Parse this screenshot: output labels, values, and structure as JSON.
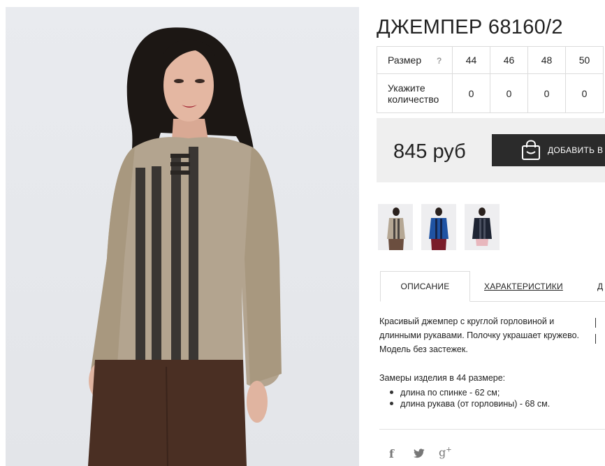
{
  "product": {
    "title": "ДЖЕМПЕР 68160/2"
  },
  "sizes": {
    "size_label": "Размер",
    "help": "?",
    "quantity_label_line1": "Укажите",
    "quantity_label_line2": "количество",
    "columns": [
      {
        "size": "44",
        "qty": "0"
      },
      {
        "size": "46",
        "qty": "0"
      },
      {
        "size": "48",
        "qty": "0"
      },
      {
        "size": "50",
        "qty": "0"
      }
    ]
  },
  "price": {
    "value": "845 руб",
    "add_to_cart": "ДОБАВИТЬ В"
  },
  "thumbnails": [
    "beige-jumper",
    "blue-jumper",
    "navy-jumper"
  ],
  "tabs": {
    "description": "ОПИСАНИЕ",
    "characteristics": "ХАРАКТЕРИСТИКИ",
    "third": "Д"
  },
  "description": {
    "text": "Красивый джемпер с круглой горловиной и длинными рукавами. Полочку украшает кружево. Модель без застежек.",
    "measures_title": "Замеры изделия в 44 размере:",
    "measures": [
      "длина по спинке - 62 см;",
      "длина рукава (от горловины) - 68 см."
    ]
  },
  "social": [
    "facebook-icon",
    "twitter-icon",
    "google-plus-icon"
  ],
  "colors": {
    "button": "#2b2b2b",
    "price_box": "#efefef",
    "border": "#dcdcdc"
  }
}
